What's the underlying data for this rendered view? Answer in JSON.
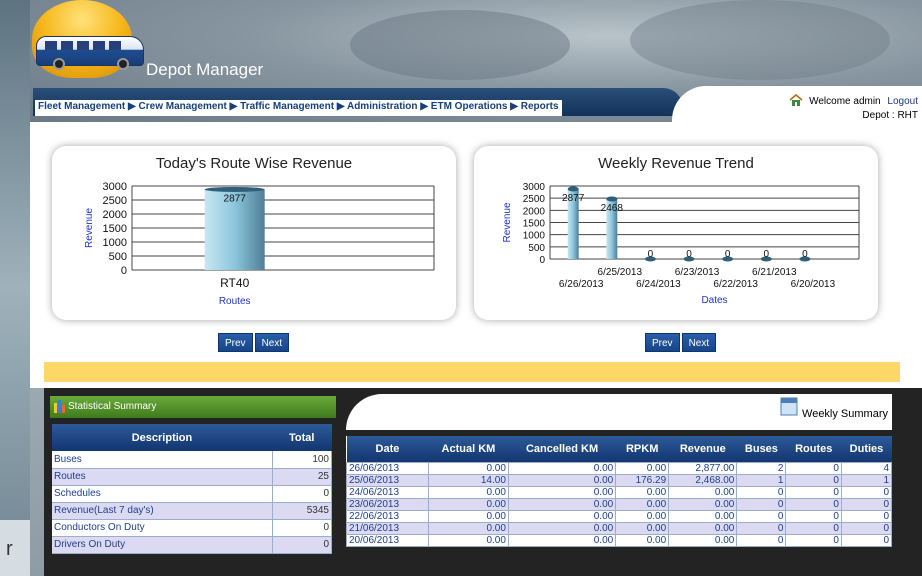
{
  "app": {
    "title": "Depot Manager"
  },
  "nav": {
    "items": [
      "Fleet Management",
      "Crew Management",
      "Traffic Management",
      "Administration",
      "ETM Operations",
      "Reports"
    ],
    "separator": "▶"
  },
  "user": {
    "welcome": "Welcome admin",
    "logout": "Logout",
    "depot": "Depot : RHT"
  },
  "pager": {
    "prev": "Prev",
    "next": "Next"
  },
  "chart_data": [
    {
      "type": "bar",
      "title": "Today's Route Wise Revenue",
      "xlabel": "Routes",
      "ylabel": "Revenue",
      "categories": [
        "RT40"
      ],
      "values": [
        2877
      ],
      "data_labels": [
        "2877"
      ],
      "ylim": [
        0,
        3000
      ],
      "yticks": [
        0,
        500,
        1000,
        1500,
        2000,
        2500,
        3000
      ],
      "grid": true
    },
    {
      "type": "bar",
      "title": "Weekly Revenue Trend",
      "xlabel": "Dates",
      "ylabel": "Revenue",
      "categories": [
        "6/26/2013",
        "6/25/2013",
        "6/24/2013",
        "6/23/2013",
        "6/22/2013",
        "6/21/2013",
        "6/20/2013"
      ],
      "values": [
        2877,
        2468,
        0,
        0,
        0,
        0,
        0
      ],
      "data_labels": [
        "2877",
        "2468",
        "0",
        "0",
        "0",
        "0",
        "0"
      ],
      "ylim": [
        0,
        3000
      ],
      "yticks": [
        0,
        500,
        1000,
        1500,
        2000,
        2500,
        3000
      ],
      "grid": true
    }
  ],
  "colors": {
    "bar": "#8cc6dc",
    "accent": "#1a3e78",
    "summary_green": "#4f8c27",
    "highlight": "#fdd768"
  },
  "stat_summary": {
    "title": "Statistical Summary",
    "headers": [
      "Description",
      "Total"
    ],
    "rows": [
      [
        "Buses",
        "100"
      ],
      [
        "Routes",
        "25"
      ],
      [
        "Schedules",
        "0"
      ],
      [
        "Revenue(Last 7 day's)",
        "5345"
      ],
      [
        "Conductors On Duty",
        "0"
      ],
      [
        "Drivers On Duty",
        "0"
      ]
    ]
  },
  "weekly_summary": {
    "title": "Weekly Summary",
    "headers": [
      "Date",
      "Actual KM",
      "Cancelled KM",
      "RPKM",
      "Revenue",
      "Buses",
      "Routes",
      "Duties"
    ],
    "rows": [
      [
        "26/06/2013",
        "0.00",
        "0.00",
        "0.00",
        "2,877.00",
        "2",
        "0",
        "4"
      ],
      [
        "25/06/2013",
        "14.00",
        "0.00",
        "176.29",
        "2,468.00",
        "1",
        "0",
        "1"
      ],
      [
        "24/06/2013",
        "0.00",
        "0.00",
        "0.00",
        "0.00",
        "0",
        "0",
        "0"
      ],
      [
        "23/06/2013",
        "0.00",
        "0.00",
        "0.00",
        "0.00",
        "0",
        "0",
        "0"
      ],
      [
        "22/06/2013",
        "0.00",
        "0.00",
        "0.00",
        "0.00",
        "0",
        "0",
        "0"
      ],
      [
        "21/06/2013",
        "0.00",
        "0.00",
        "0.00",
        "0.00",
        "0",
        "0",
        "0"
      ],
      [
        "20/06/2013",
        "0.00",
        "0.00",
        "0.00",
        "0.00",
        "0",
        "0",
        "0"
      ]
    ]
  }
}
